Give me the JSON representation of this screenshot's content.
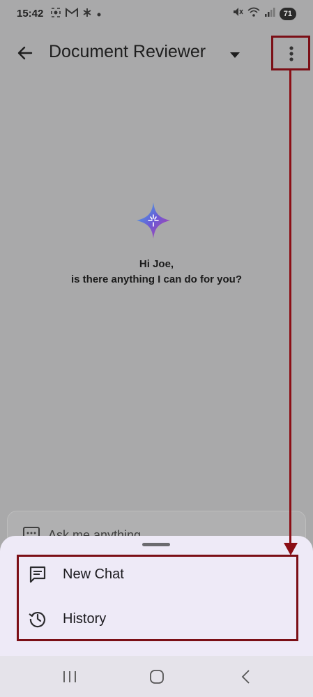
{
  "status_bar": {
    "time": "15:42",
    "battery": "71",
    "left_icons": [
      "screenshot-icon",
      "gmail-icon",
      "asterisk-icon",
      "dot-icon"
    ],
    "right_icons": [
      "mute-icon",
      "wifi-icon",
      "signal-icon"
    ]
  },
  "app_bar": {
    "title": "Document Reviewer",
    "back_icon": "arrow-left-icon",
    "dropdown_icon": "caret-down-icon",
    "more_icon": "more-vertical-icon"
  },
  "main": {
    "logo_icon": "sparkle-logo-icon",
    "greeting_line1": "Hi Joe,",
    "greeting_line2": "is there anything I can do for you?"
  },
  "input": {
    "placeholder": "Ask me anything",
    "icon": "chat-dots-icon"
  },
  "bottom_sheet": {
    "items": [
      {
        "label": "New Chat",
        "icon": "message-icon"
      },
      {
        "label": "History",
        "icon": "history-icon"
      }
    ]
  },
  "nav_bar": {
    "buttons": [
      "recents-icon",
      "home-icon",
      "back-icon"
    ]
  },
  "colors": {
    "overlay_background": "#a9a9aa",
    "sheet_background": "#eeeaf7",
    "highlight": "#7b0f16"
  }
}
